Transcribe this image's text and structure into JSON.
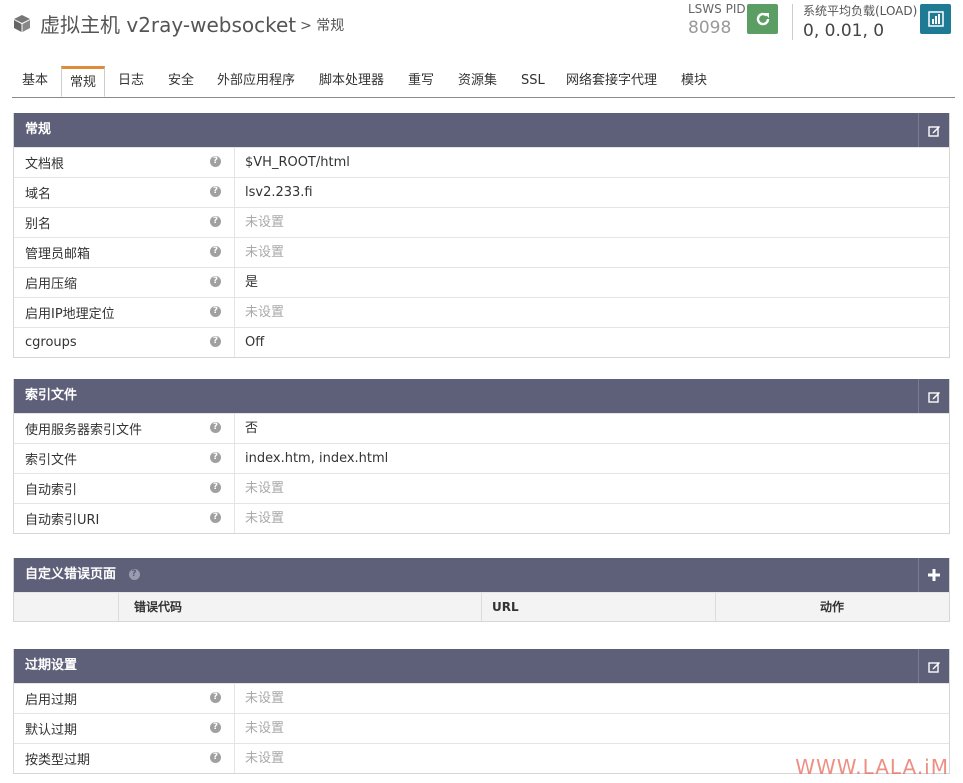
{
  "header": {
    "title": "虚拟主机 v2ray-websocket",
    "breadcrumb": "> 常规",
    "pid_label": "LSWS PID",
    "pid_value": "8098",
    "load_label": "系统平均负载(LOAD)",
    "load_value": "0, 0.01, 0"
  },
  "tabs": [
    {
      "label": "基本"
    },
    {
      "label": "常规"
    },
    {
      "label": "日志"
    },
    {
      "label": "安全"
    },
    {
      "label": "外部应用程序"
    },
    {
      "label": "脚本处理器"
    },
    {
      "label": "重写"
    },
    {
      "label": "资源集"
    },
    {
      "label": "SSL"
    },
    {
      "label": "网络套接字代理"
    },
    {
      "label": "模块"
    }
  ],
  "general": {
    "title": "常规",
    "rows": [
      {
        "key": "文档根",
        "value": "$VH_ROOT/html"
      },
      {
        "key": "域名",
        "value": "lsv2.233.fi"
      },
      {
        "key": "别名",
        "value": "未设置"
      },
      {
        "key": "管理员邮箱",
        "value": "未设置"
      },
      {
        "key": "启用压缩",
        "value": "是"
      },
      {
        "key": "启用IP地理定位",
        "value": "未设置"
      },
      {
        "key": "cgroups",
        "value": "Off"
      }
    ]
  },
  "index": {
    "title": "索引文件",
    "rows": [
      {
        "key": "使用服务器索引文件",
        "value": "否"
      },
      {
        "key": "索引文件",
        "value": "index.htm, index.html"
      },
      {
        "key": "自动索引",
        "value": "未设置"
      },
      {
        "key": "自动索引URI",
        "value": "未设置"
      }
    ]
  },
  "errors": {
    "title": "自定义错误页面",
    "columns": [
      "错误代码",
      "URL",
      "动作"
    ]
  },
  "expires": {
    "title": "过期设置",
    "rows": [
      {
        "key": "启用过期",
        "value": "未设置"
      },
      {
        "key": "默认过期",
        "value": "未设置"
      },
      {
        "key": "按类型过期",
        "value": "未设置"
      }
    ]
  },
  "watermark": "WWW.LALA.iM",
  "colors": {
    "panel_header": "#5e6079",
    "tab_accent": "#e08b39",
    "restart_button": "#5a9e63",
    "stats_button": "#1f7a94",
    "muted_text": "#a9a9a9"
  }
}
